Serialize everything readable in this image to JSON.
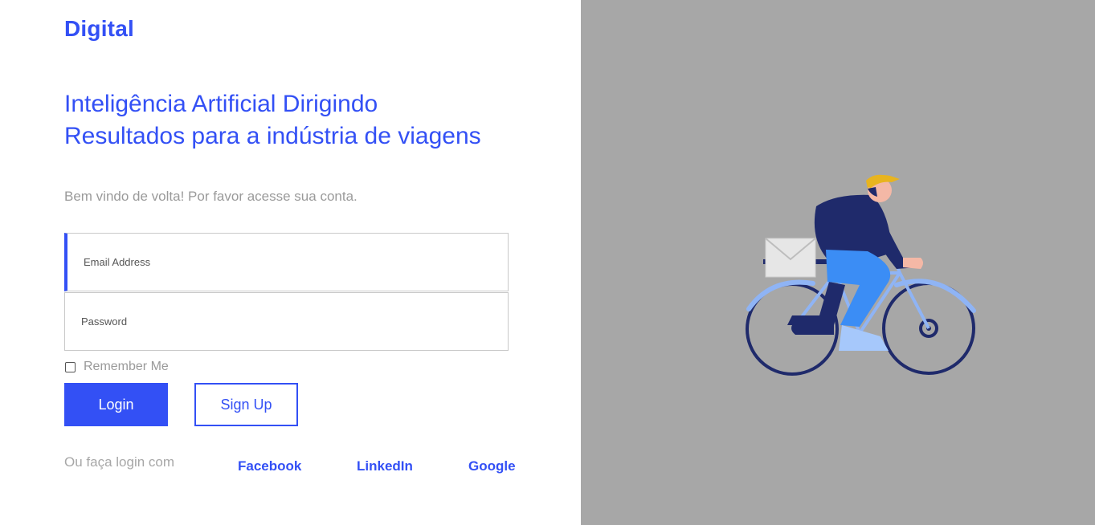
{
  "brand": "Digital",
  "headline": {
    "line1": "Inteligência Artificial Dirigindo",
    "line2": "Resultados para a indústria de viagens"
  },
  "welcome_text": "Bem vindo de volta! Por favor acesse sua conta.",
  "form": {
    "email_placeholder": "Email Address",
    "email_value": "",
    "password_placeholder": "Password",
    "password_value": "",
    "remember_label": "Remember Me",
    "remember_checked": false,
    "login_label": "Login",
    "signup_label": "Sign Up"
  },
  "social": {
    "prefix": "Ou faça login com",
    "providers": [
      "Facebook",
      "LinkedIn",
      "Google"
    ]
  },
  "illustration": {
    "subject": "cyclist-delivery-icon"
  },
  "colors": {
    "accent": "#3350f5",
    "panel_bg": "#a7a7a7",
    "muted_text": "#9a9a9a"
  }
}
